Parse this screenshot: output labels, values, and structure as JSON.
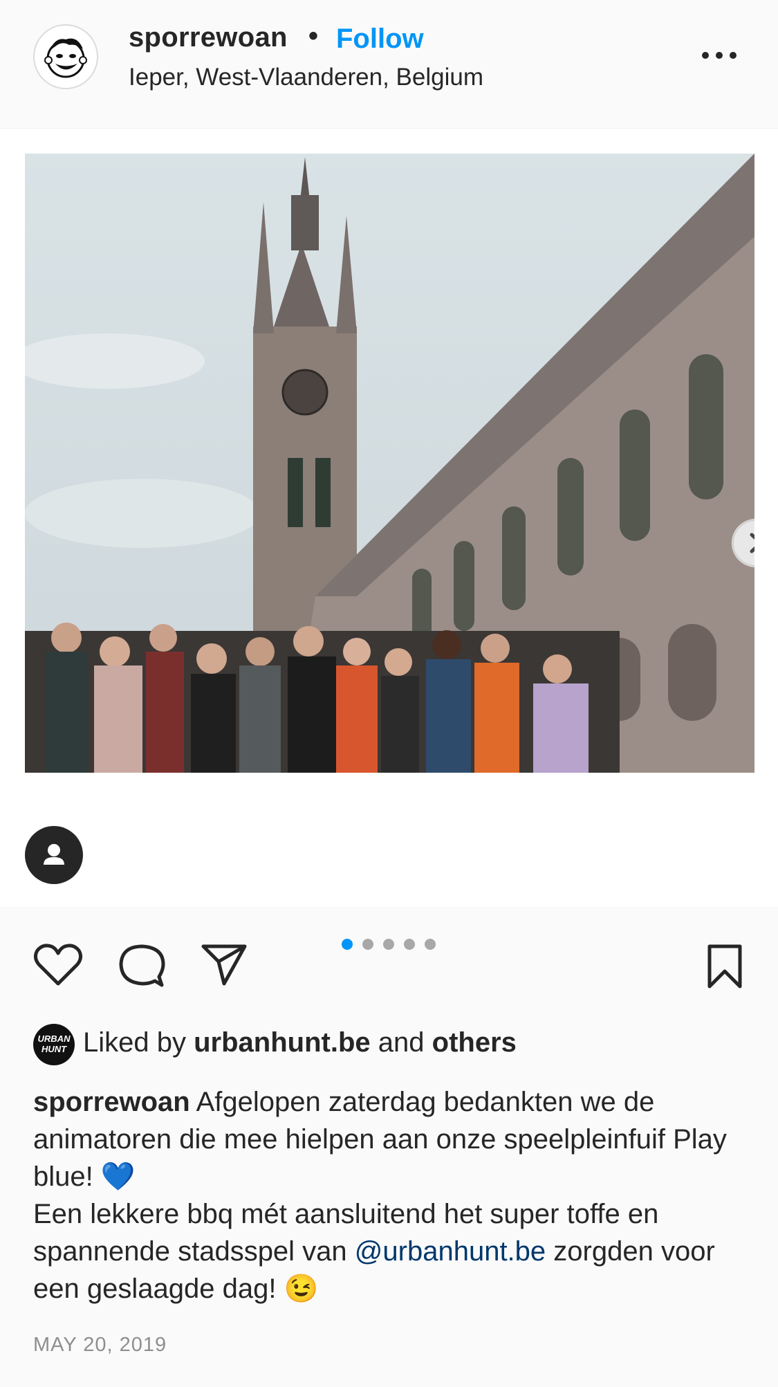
{
  "header": {
    "username": "sporrewoan",
    "separator": "•",
    "follow_label": "Follow",
    "location": "Ieper, West-Vlaanderen, Belgium",
    "more_icon": "more-horizontal-icon"
  },
  "post": {
    "photo_icon": "photo",
    "carousel_count": 5,
    "carousel_active": 1
  },
  "actions": {
    "like_icon": "heart-icon",
    "comment_icon": "comment-icon",
    "share_icon": "send-icon",
    "save_icon": "bookmark-icon"
  },
  "likes": {
    "avatar_text_line1": "URBAN",
    "avatar_text_line2": "HUNT",
    "prefix": "Liked by",
    "user": "urbanhunt.be",
    "conj": "and",
    "others": "others"
  },
  "caption": {
    "username": "sporrewoan",
    "line1": "Afgelopen zaterdag bedankten we de animatoren die mee hielpen aan onze speelpleinfuif Play blue! 💙",
    "line2_pre": "Een lekkere bbq mét aansluitend het super toffe en spannende stadsspel van",
    "mention": "@urbanhunt.be",
    "line2_post": "zorgden voor een geslaagde dag! 😉"
  },
  "date": "MAY 20, 2019",
  "colors": {
    "accent": "#0095f6",
    "text": "#262626",
    "muted": "#8e8e8e",
    "mention": "#00376b"
  }
}
